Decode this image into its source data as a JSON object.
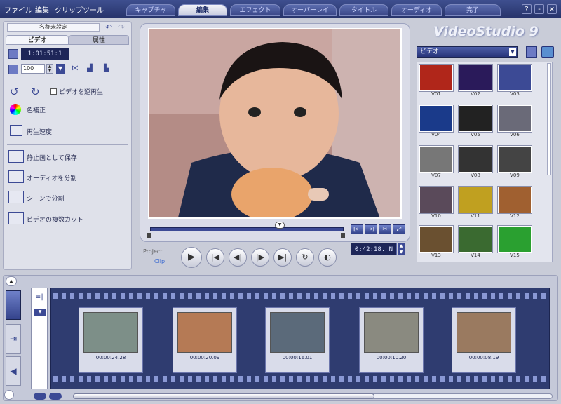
{
  "menu": [
    "ファイル",
    "編集",
    "クリップ",
    "ツール"
  ],
  "tabs": [
    {
      "label": "キャプチャ",
      "active": false
    },
    {
      "label": "編集",
      "active": true
    },
    {
      "label": "エフェクト",
      "active": false
    },
    {
      "label": "オーバーレイ",
      "active": false
    },
    {
      "label": "タイトル",
      "active": false
    },
    {
      "label": "オーディオ",
      "active": false
    },
    {
      "label": "完了",
      "active": false
    }
  ],
  "window_buttons": [
    "?",
    "-",
    "×"
  ],
  "left": {
    "clip_name": "名称未設定",
    "subtabs": [
      "ビデオ",
      "属性"
    ],
    "duration": "1:01:51:1",
    "volume": "100",
    "reverse_label": "ビデオを逆再生",
    "color_label": "色補正",
    "speed_label": "再生速度",
    "actions": [
      "静止画として保存",
      "オーディオを分割",
      "シーンで分割",
      "ビデオの複数カット"
    ]
  },
  "preview": {
    "project_label": "Project",
    "clip_label": "Clip",
    "timecode": "0:42:18. N"
  },
  "library": {
    "logo": "VideoStudio 9",
    "category": "ビデオ",
    "items": [
      "V01",
      "V02",
      "V03",
      "V04",
      "V05",
      "V06",
      "V07",
      "V08",
      "V09",
      "V10",
      "V11",
      "V12",
      "V13",
      "V14",
      "V15"
    ]
  },
  "timeline": {
    "clips": [
      {
        "time": "00:00:24.28",
        "img": "sea"
      },
      {
        "time": "00:00:20.09",
        "img": "boy"
      },
      {
        "time": "00:00:16.01",
        "img": "rocks"
      },
      {
        "time": "00:00:10.20",
        "img": "penguin"
      },
      {
        "time": "00:00:08.19",
        "img": "people"
      }
    ]
  },
  "colors": {
    "accent": "#27336a",
    "timeline": "#2f3c70"
  }
}
